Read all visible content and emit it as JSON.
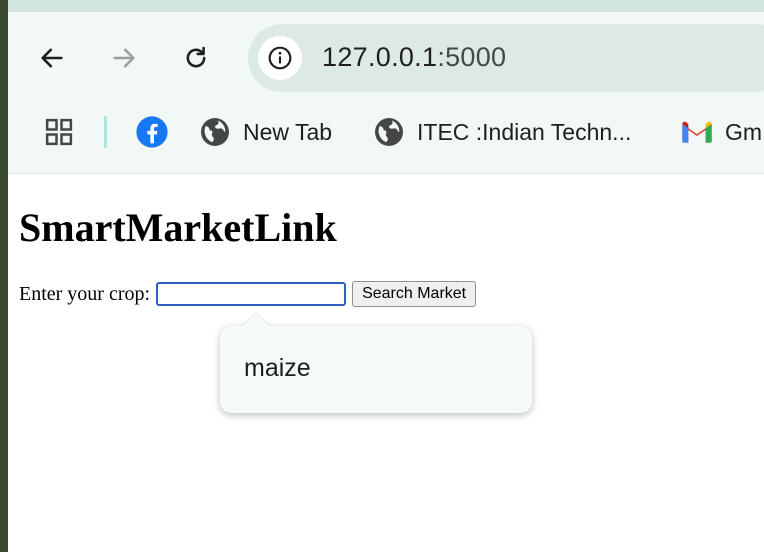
{
  "browser": {
    "address": {
      "host": "127.0.0.1",
      "port": ":5000"
    },
    "bookmarks": [
      {
        "label": "",
        "icon": "facebook-icon"
      },
      {
        "label": "New Tab",
        "icon": "globe-icon"
      },
      {
        "label": "ITEC :Indian Techn...",
        "icon": "globe-icon"
      },
      {
        "label": "Gm",
        "icon": "gmail-icon"
      }
    ]
  },
  "page": {
    "title": "SmartMarketLink",
    "crop_label": "Enter your crop:",
    "crop_value": "",
    "search_button": "Search Market",
    "suggestions": [
      "maize"
    ]
  },
  "colors": {
    "toolbar_bg": "#f1f8f6",
    "omnibox_bg": "#dce9e5",
    "facebook_blue": "#1877f2",
    "input_focus": "#2f5fbf"
  }
}
